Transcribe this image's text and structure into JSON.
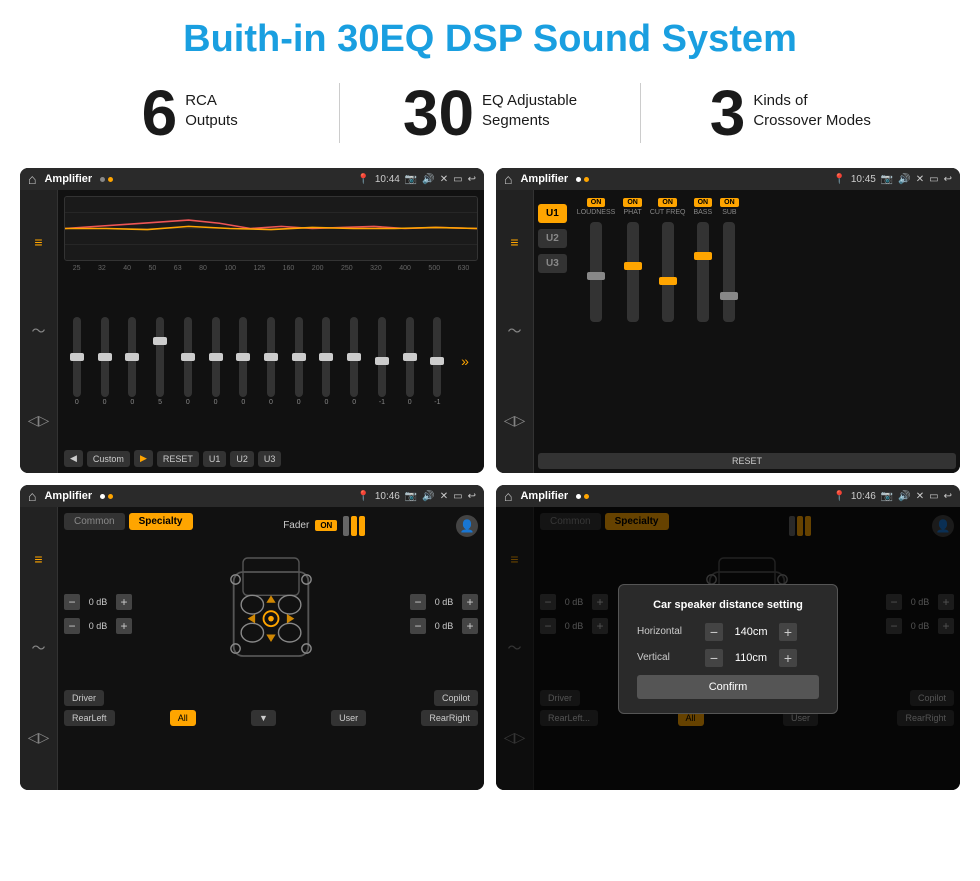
{
  "page": {
    "title": "Buith-in 30EQ DSP Sound System"
  },
  "stats": [
    {
      "number": "6",
      "line1": "RCA",
      "line2": "Outputs"
    },
    {
      "number": "30",
      "line1": "EQ Adjustable",
      "line2": "Segments"
    },
    {
      "number": "3",
      "line1": "Kinds of",
      "line2": "Crossover Modes"
    }
  ],
  "screens": [
    {
      "id": "screen1",
      "status": {
        "title": "Amplifier",
        "time": "10:44"
      },
      "type": "eq",
      "freq_labels": [
        "25",
        "32",
        "40",
        "50",
        "63",
        "80",
        "100",
        "125",
        "160",
        "200",
        "250",
        "320",
        "400",
        "500",
        "630"
      ],
      "values": [
        "0",
        "0",
        "0",
        "5",
        "0",
        "0",
        "0",
        "0",
        "0",
        "0",
        "0",
        "-1",
        "0",
        "-1"
      ],
      "preset": "Custom",
      "buttons": [
        "RESET",
        "U1",
        "U2",
        "U3"
      ]
    },
    {
      "id": "screen2",
      "status": {
        "title": "Amplifier",
        "time": "10:45"
      },
      "type": "amplifier",
      "u_buttons": [
        "U1",
        "U2",
        "U3"
      ],
      "groups": [
        {
          "label": "LOUDNESS",
          "on": true
        },
        {
          "label": "PHAT",
          "on": true
        },
        {
          "label": "CUT FREQ",
          "on": true
        },
        {
          "label": "BASS",
          "on": true
        },
        {
          "label": "SUB",
          "on": true
        }
      ]
    },
    {
      "id": "screen3",
      "status": {
        "title": "Amplifier",
        "time": "10:46"
      },
      "type": "crossover",
      "tabs": [
        "Common",
        "Specialty"
      ],
      "active_tab": "Specialty",
      "fader_label": "Fader",
      "fader_on": "ON",
      "db_values": [
        "0 dB",
        "0 dB",
        "0 dB",
        "0 dB"
      ],
      "bottom_buttons": [
        "Driver",
        "Copilot",
        "RearLeft",
        "All",
        "User",
        "RearRight"
      ]
    },
    {
      "id": "screen4",
      "status": {
        "title": "Amplifier",
        "time": "10:46"
      },
      "type": "crossover_dialog",
      "tabs": [
        "Common",
        "Specialty"
      ],
      "active_tab": "Specialty",
      "dialog": {
        "title": "Car speaker distance setting",
        "horizontal_label": "Horizontal",
        "horizontal_value": "140cm",
        "vertical_label": "Vertical",
        "vertical_value": "110cm",
        "confirm_label": "Confirm"
      },
      "db_values": [
        "0 dB",
        "0 dB"
      ],
      "bottom_buttons": [
        "Driver",
        "Copilot",
        "RearLeft",
        "All",
        "User",
        "RearRight"
      ]
    }
  ]
}
